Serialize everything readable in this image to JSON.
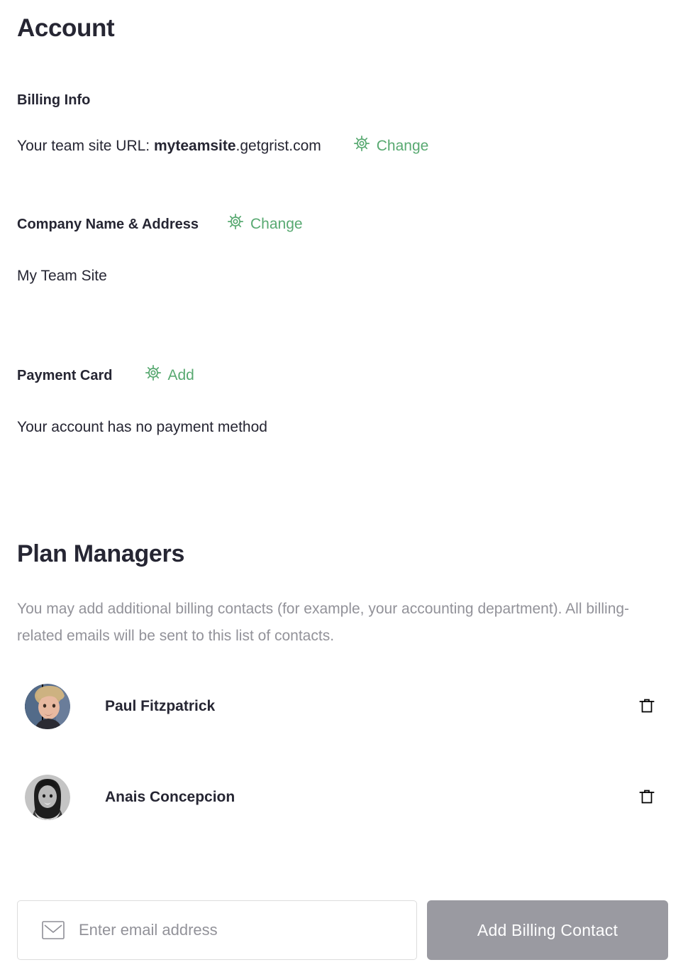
{
  "page": {
    "title": "Account"
  },
  "colors": {
    "accent_green": "#58a971",
    "text_dark": "#262633",
    "text_muted": "#929299",
    "button_disabled": "#9a9aa1",
    "input_border": "#dcdcdc"
  },
  "billing_info": {
    "heading": "Billing Info",
    "url_label": "Your team site URL: ",
    "url_subdomain": "myteamsite",
    "url_domain": ".getgrist.com",
    "change_label": "Change",
    "change_icon": "gear-icon"
  },
  "company": {
    "heading": "Company Name & Address",
    "change_label": "Change",
    "change_icon": "gear-icon",
    "value": "My Team Site"
  },
  "payment_card": {
    "heading": "Payment Card",
    "add_label": "Add",
    "add_icon": "gear-icon",
    "value": "Your account has no payment method"
  },
  "plan_managers": {
    "heading": "Plan Managers",
    "description": "You may add additional billing contacts (for example, your accounting department). All billing-related emails will be sent to this list of contacts.",
    "contacts": [
      {
        "name": "Paul Fitzpatrick",
        "avatar": "avatar-paul-fitzpatrick",
        "remove_icon": "trash-icon"
      },
      {
        "name": "Anais Concepcion",
        "avatar": "avatar-anais-concepcion",
        "remove_icon": "trash-icon"
      }
    ],
    "add_contact": {
      "email_placeholder": "Enter email address",
      "email_value": "",
      "email_icon": "envelope-icon",
      "button_label": "Add Billing Contact",
      "button_disabled": true
    }
  }
}
